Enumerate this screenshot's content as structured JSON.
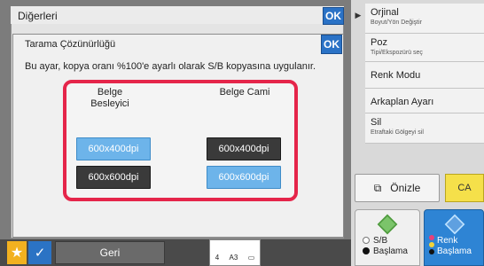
{
  "right_panel": {
    "items": [
      {
        "label": "Orjinal",
        "sub": "Boyut/Yön Değiştir"
      },
      {
        "label": "Poz",
        "sub": "Tipi/Ekspozürü seç"
      },
      {
        "label": "Renk Modu",
        "sub": ""
      },
      {
        "label": "Arkaplan Ayarı",
        "sub": ""
      },
      {
        "label": "Sil",
        "sub": "Etraftaki Gölgeyi sil"
      }
    ],
    "preview_label": "Önizle",
    "ca_label": "CA",
    "bw_start": {
      "line1": "S/B",
      "line2": "Başlama"
    },
    "color_start": {
      "line1": "Renk",
      "line2": "Başlama"
    }
  },
  "bottom": {
    "back_label": "Geri",
    "counter_left": "4",
    "counter_mid": "A3"
  },
  "outer_dialog": {
    "title": "Diğerleri",
    "ok": "OK"
  },
  "inner_dialog": {
    "title": "Tarama Çözünürlüğü",
    "ok": "OK",
    "description": "Bu ayar, kopya oranı %100'e ayarlı olarak S/B kopyasına uygulanır.",
    "columns": [
      {
        "header": "Belge\nBesleyici",
        "options": [
          {
            "label": "600x400dpi",
            "selected": true
          },
          {
            "label": "600x600dpi",
            "selected": false
          }
        ]
      },
      {
        "header": "Belge Cami",
        "options": [
          {
            "label": "600x400dpi",
            "selected": false
          },
          {
            "label": "600x600dpi",
            "selected": true
          }
        ]
      }
    ]
  },
  "colors": {
    "accent": "#2a72c6",
    "highlight_frame": "#e5254a",
    "selected": "#6db4ea"
  }
}
